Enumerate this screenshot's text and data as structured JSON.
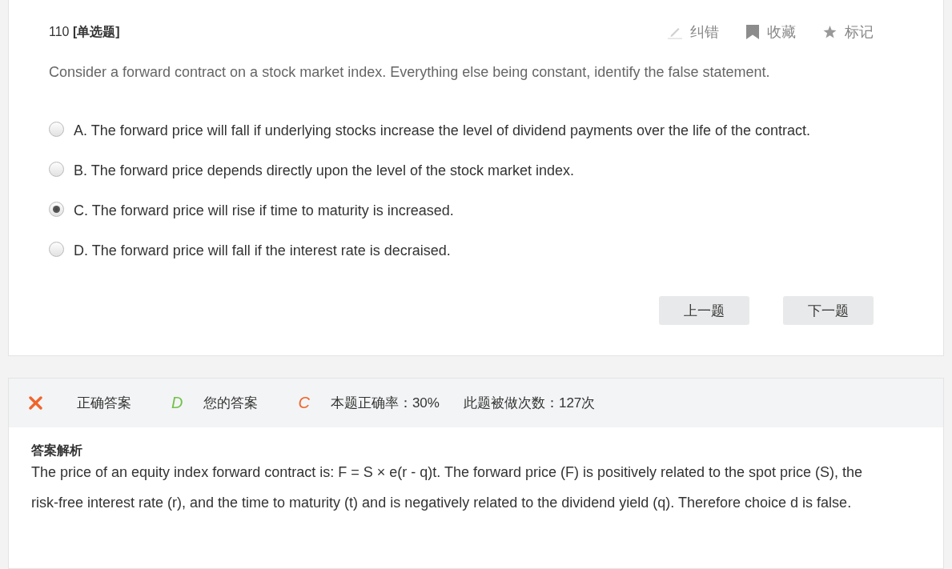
{
  "question": {
    "heading": "110 **[单选题]**",
    "actions": [
      {
        "kind": "report",
        "label": "纠错"
      },
      {
        "kind": "favorite",
        "label": "收藏"
      },
      {
        "kind": "mark",
        "label": "标记"
      }
    ],
    "text": "Consider a forward contract on a stock market index. Everything else being constant, identify the false statement.",
    "options": [
      {
        "label": "A. The forward price will fall if underlying stocks increase the level of dividend payments over the life of the contract.",
        "selected": false
      },
      {
        "label": "B. The forward price depends directly upon the level of the stock market index.",
        "selected": false
      },
      {
        "label": "C. The forward price will rise if time to maturity is increased.",
        "selected": true
      },
      {
        "label": "D. The forward price will fall if the interest rate is decraised.",
        "selected": false
      }
    ],
    "buttons": [
      "上一题",
      "下一题"
    ]
  },
  "result": {
    "correct": false,
    "correct_answer_label": "正确答案",
    "correct_answer": "D",
    "your_answer_label": "您的答案",
    "your_answer": "C",
    "accuracy": "本题正确率：30%",
    "attempts": "此题被做次数：127次"
  },
  "explanation": {
    "title": "答案解析",
    "text": "The price of an equity index forward contract is: F = S × e(r - q)t. The forward price (F) is positively related to the spot price (S), the risk-free interest rate (r), and the time to maturity (t) and is negatively related to the dividend yield (q). Therefore choice d is false."
  }
}
